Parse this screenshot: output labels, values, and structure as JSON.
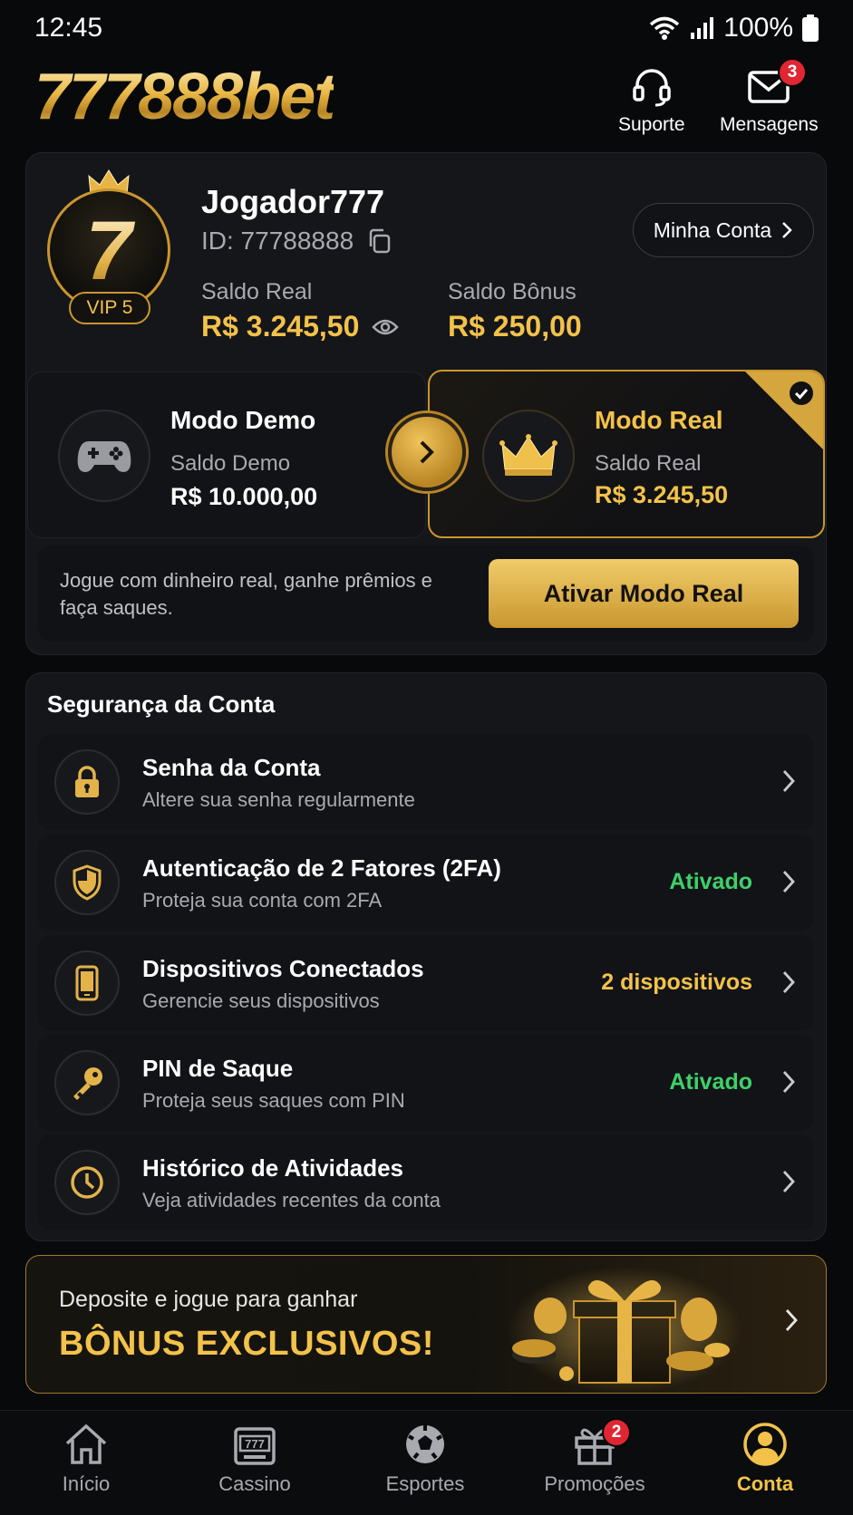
{
  "status_bar": {
    "time": "12:45",
    "battery": "100%"
  },
  "header": {
    "logo": "777888bet",
    "support_label": "Suporte",
    "messages_label": "Mensagens",
    "messages_badge": "3"
  },
  "profile": {
    "avatar_symbol": "7",
    "vip": "VIP 5",
    "username": "Jogador777",
    "id": "ID: 77788888",
    "account_button": "Minha Conta",
    "real_balance_label": "Saldo Real",
    "real_balance_value": "R$ 3.245,50",
    "bonus_balance_label": "Saldo Bônus",
    "bonus_balance_value": "R$ 250,00"
  },
  "modes": {
    "demo": {
      "title": "Modo Demo",
      "label": "Saldo Demo",
      "value": "R$ 10.000,00"
    },
    "real": {
      "title": "Modo Real",
      "label": "Saldo Real",
      "value": "R$ 3.245,50",
      "selected": true
    },
    "description": "Jogue com dinheiro real, ganhe prêmios e faça saques.",
    "activate_button": "Ativar Modo Real"
  },
  "security": {
    "title": "Segurança da Conta",
    "items": [
      {
        "title": "Senha da Conta",
        "subtitle": "Altere sua senha regularmente",
        "status": "",
        "icon": "lock-icon"
      },
      {
        "title": "Autenticação de 2 Fatores (2FA)",
        "subtitle": "Proteja sua conta com 2FA",
        "status": "Ativado",
        "icon": "shield-icon"
      },
      {
        "title": "Dispositivos Conectados",
        "subtitle": "Gerencie seus dispositivos",
        "status": "2 dispositivos",
        "icon": "phone-icon"
      },
      {
        "title": "PIN de Saque",
        "subtitle": "Proteja seus saques com PIN",
        "status": "Ativado",
        "icon": "key-icon"
      },
      {
        "title": "Histórico de Atividades",
        "subtitle": "Veja atividades recentes da conta",
        "status": "",
        "icon": "clock-icon"
      }
    ]
  },
  "promo": {
    "line1": "Deposite e jogue para ganhar",
    "line2": "BÔNUS EXCLUSIVOS!"
  },
  "bottom_nav": {
    "items": [
      {
        "label": "Início",
        "icon": "home-icon"
      },
      {
        "label": "Cassino",
        "icon": "slot-machine-icon",
        "glyph": "777"
      },
      {
        "label": "Esportes",
        "icon": "soccer-ball-icon"
      },
      {
        "label": "Promoções",
        "icon": "gift-icon",
        "badge": "2"
      },
      {
        "label": "Conta",
        "icon": "user-icon",
        "active": true
      }
    ]
  },
  "colors": {
    "accent": "#f3c24a",
    "success": "#3fd06a",
    "badge": "#e02632",
    "background": "#08090b"
  }
}
